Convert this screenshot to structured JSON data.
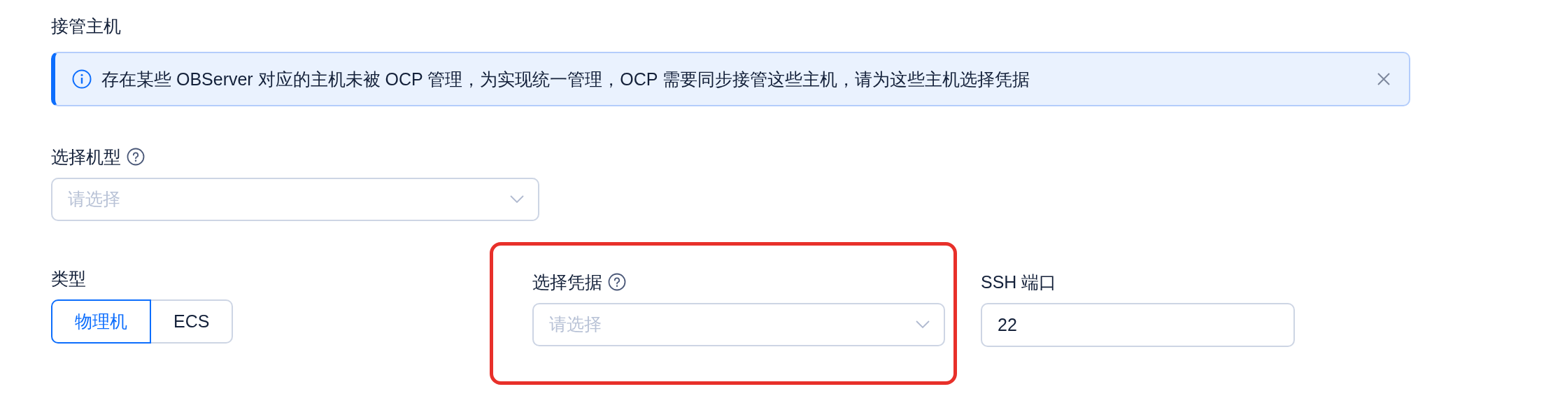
{
  "section_title": "接管主机",
  "alert": {
    "kind": "info",
    "message": "存在某些 OBServer 对应的主机未被 OCP 管理，为实现统一管理，OCP 需要同步接管这些主机，请为这些主机选择凭据",
    "closable": true
  },
  "machine_model": {
    "label": "选择机型",
    "help": true,
    "placeholder": "请选择"
  },
  "type": {
    "label": "类型",
    "options": [
      {
        "label": "物理机",
        "selected": true
      },
      {
        "label": "ECS",
        "selected": false
      }
    ]
  },
  "credential": {
    "label": "选择凭据",
    "help": true,
    "placeholder": "请选择",
    "highlighted": true
  },
  "ssh_port": {
    "label": "SSH 端口",
    "value": "22"
  }
}
